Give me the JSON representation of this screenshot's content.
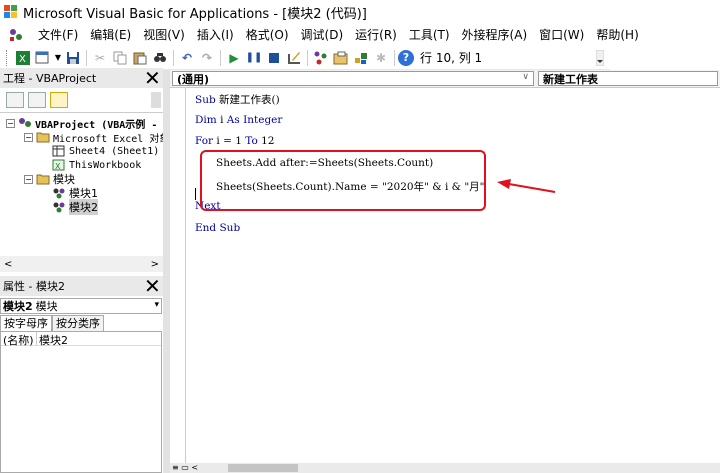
{
  "window": {
    "title": "Microsoft Visual Basic for Applications - [模块2 (代码)]"
  },
  "menu": {
    "items": [
      "文件(F)",
      "编辑(E)",
      "视图(V)",
      "插入(I)",
      "格式(O)",
      "调试(D)",
      "运行(R)",
      "工具(T)",
      "外接程序(A)",
      "窗口(W)",
      "帮助(H)"
    ]
  },
  "toolbar": {
    "icons": [
      "excel-icon",
      "insert-module-icon",
      "save-icon",
      "cut-icon",
      "copy-icon",
      "paste-icon",
      "find-icon",
      "undo-icon",
      "redo-icon",
      "run-icon",
      "break-icon",
      "reset-icon",
      "design-mode-icon",
      "project-explorer-icon",
      "properties-icon",
      "object-browser-icon",
      "toolbox-icon",
      "help-icon"
    ],
    "position_label": "行 10, 列 1"
  },
  "project_panel": {
    "title": "工程 - VBAProject",
    "root": "VBAProject (VBA示例 -",
    "folder_excel": "Microsoft Excel 对象",
    "sheet": "Sheet4 (Sheet1)",
    "workbook": "ThisWorkbook",
    "folder_modules": "模块",
    "module1": "模块1",
    "module2": "模块2"
  },
  "properties_panel": {
    "title": "属性 - 模块2",
    "object_name": "模块2",
    "object_type": "模块",
    "tab_alpha": "按字母序",
    "tab_category": "按分类序",
    "prop_key": "(名称)",
    "prop_value": "模块2"
  },
  "code_window": {
    "object_combo": "(通用)",
    "proc_combo": "新建工作表",
    "lines": [
      "Sub 新建工作表()",
      "Dim i As Integer",
      "For i = 1 To 12",
      "Sheets.Add after:=Sheets(Sheets.Count)",
      "Sheets(Sheets.Count).Name = \"2020年\" & i & \"月\"",
      "Next",
      "End Sub"
    ]
  },
  "annotation": {
    "highlight_color": "#e0101e"
  }
}
